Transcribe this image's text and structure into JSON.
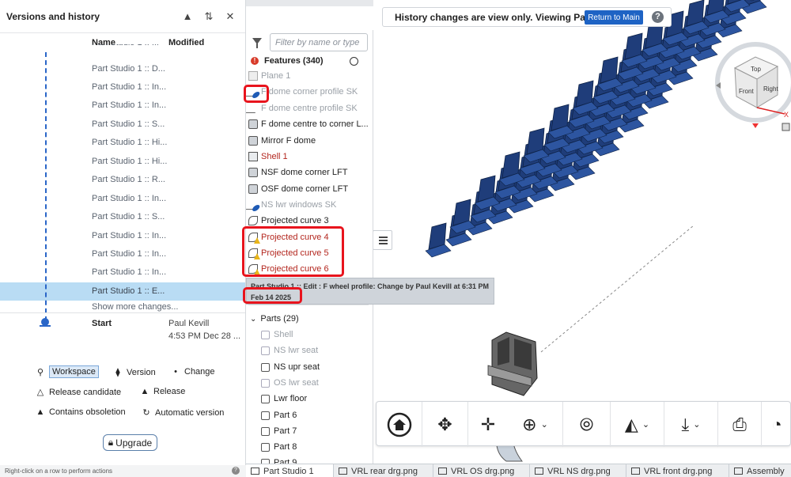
{
  "panel": {
    "title": "Versions and history",
    "col_name": "Name",
    "col_modified": "Modified",
    "rows": [
      {
        "label": "Part Studio 1 :: D..."
      },
      {
        "label": "Part Studio 1 :: In..."
      },
      {
        "label": "Part Studio 1 :: In..."
      },
      {
        "label": "Part Studio 1 :: S..."
      },
      {
        "label": "Part Studio 1 :: Hi..."
      },
      {
        "label": "Part Studio 1 :: Hi..."
      },
      {
        "label": "Part Studio 1 :: R..."
      },
      {
        "label": "Part Studio 1 :: In..."
      },
      {
        "label": "Part Studio 1 :: S..."
      },
      {
        "label": "Part Studio 1 :: In..."
      },
      {
        "label": "Part Studio 1 :: In..."
      },
      {
        "label": "Part Studio 1 :: In..."
      },
      {
        "label": "Part Studio 1 :: E..."
      }
    ],
    "show_more": "Show more changes...",
    "start_label": "Start",
    "start_author": "Paul Kevill",
    "start_time": "4:53 PM Dec 28 ...",
    "legend": {
      "workspace": "Workspace",
      "version": "Version",
      "change": "Change",
      "release_candidate": "Release candidate",
      "release": "Release",
      "contains_obsoletion": "Contains obsoletion",
      "automatic_version": "Automatic version"
    },
    "upgrade": "Upgrade",
    "footer": "Right-click on a row to perform actions"
  },
  "features": {
    "filter_placeholder": "Filter by name or type",
    "header": "Features (340)",
    "items": [
      {
        "label": "Plane 1"
      },
      {
        "label": "F dome corner profile SK"
      },
      {
        "label": "F dome centre profile SK"
      },
      {
        "label": "F dome centre to corner L..."
      },
      {
        "label": "Mirror F dome"
      },
      {
        "label": "Shell 1"
      },
      {
        "label": "NSF dome corner LFT"
      },
      {
        "label": "OSF dome corner LFT"
      },
      {
        "label": "NS lwr windows SK"
      },
      {
        "label": "Projected curve 3"
      },
      {
        "label": "Projected curve 4"
      },
      {
        "label": "Projected curve 5"
      },
      {
        "label": "Projected curve 6"
      }
    ],
    "parts_header": "Parts (29)",
    "parts": [
      {
        "label": "Shell"
      },
      {
        "label": "NS lwr seat"
      },
      {
        "label": "NS upr seat"
      },
      {
        "label": "OS lwr seat"
      },
      {
        "label": "Lwr floor"
      },
      {
        "label": "Part 6"
      },
      {
        "label": "Part 7"
      },
      {
        "label": "Part 8"
      }
    ]
  },
  "tooltip": {
    "line1": "Part Studio 1 :: Edit : F wheel profile: Change by Paul Kevill at 6:31 PM",
    "line2": "Feb 14 2025"
  },
  "banner": {
    "message": "History changes are view only. Viewing Part ...",
    "return_button": "Return to Main"
  },
  "viewcube": {
    "top": "Top",
    "front": "Front",
    "right": "Right",
    "axis_x": "X"
  },
  "tabs": [
    {
      "label": "Part Studio 1"
    },
    {
      "label": "VRL rear drg.png"
    },
    {
      "label": "VRL OS drg.png"
    },
    {
      "label": "VRL NS drg.png"
    },
    {
      "label": "VRL front drg.png"
    },
    {
      "label": "Assembly"
    }
  ],
  "colors": {
    "accent": "#1e63c4",
    "selection": "#b9dcf4",
    "highlight_box": "#e8141d",
    "seat": "#1f3d7a"
  }
}
